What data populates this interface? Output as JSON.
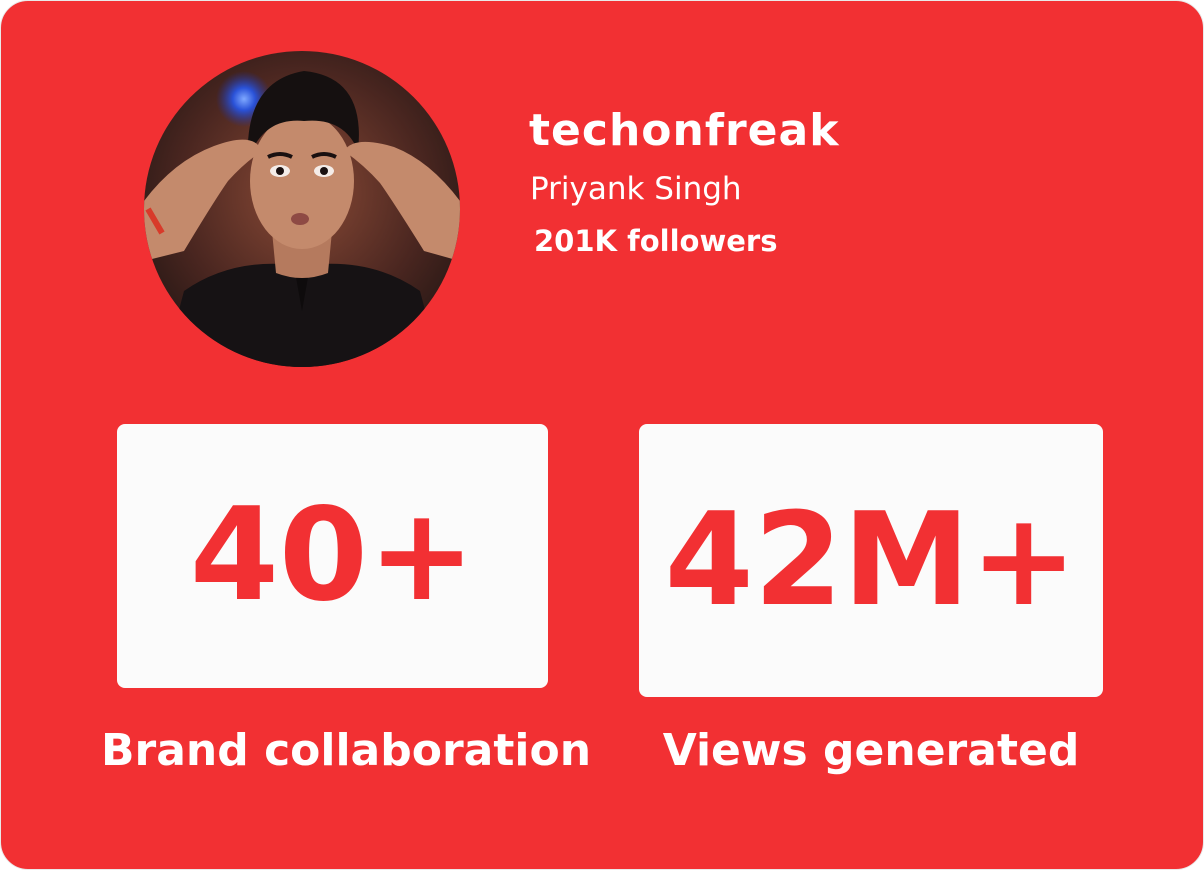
{
  "colors": {
    "card_background": "#f23033",
    "stat_box_background": "#fbfbfb",
    "stat_value_color": "#f23033",
    "text_color": "#ffffff"
  },
  "profile": {
    "avatar_icon": "profile-photo",
    "username": "techonfreak",
    "real_name": "Priyank Singh",
    "followers": "201K followers"
  },
  "stats": [
    {
      "value": "40+",
      "label": "Brand collaboration"
    },
    {
      "value": "42M+",
      "label": "Views generated"
    }
  ]
}
